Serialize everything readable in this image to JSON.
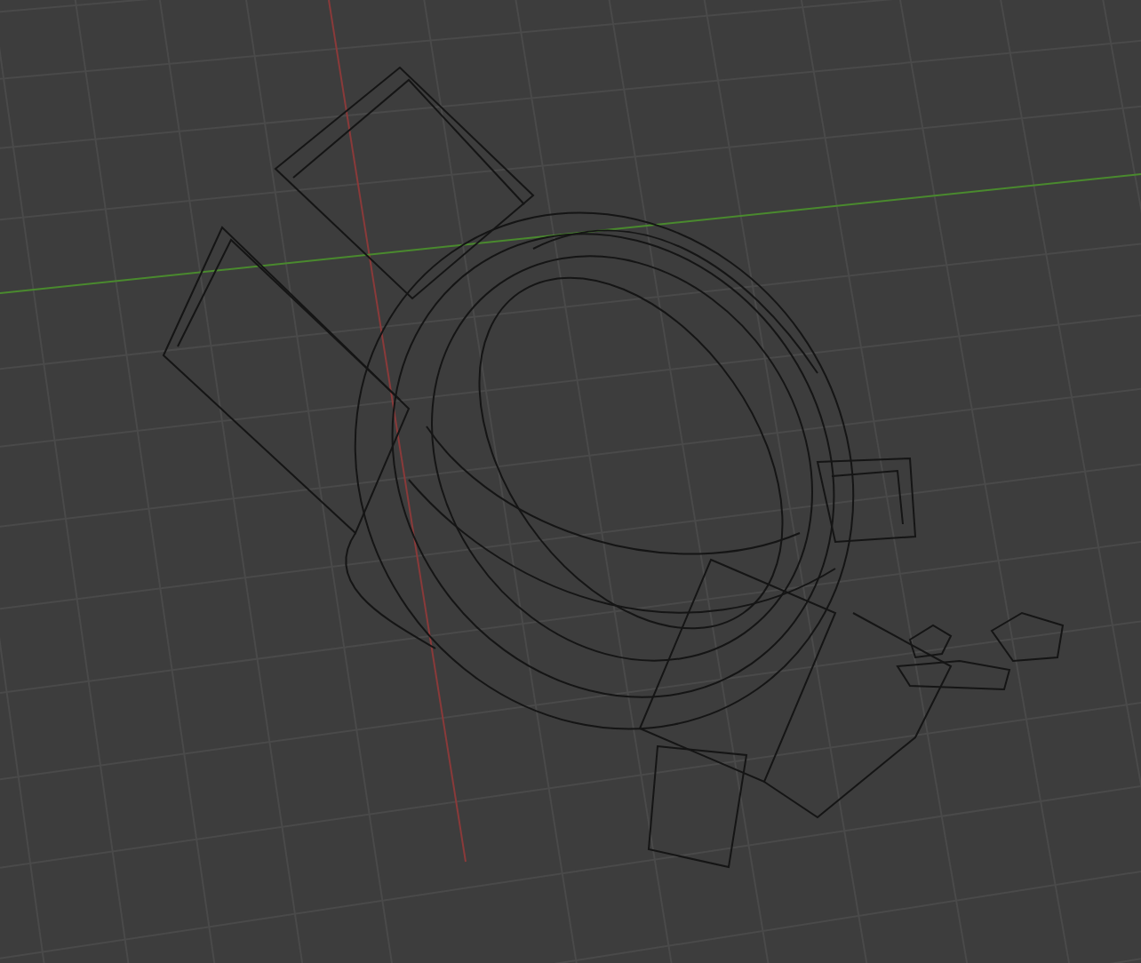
{
  "viewport": {
    "axes": [
      {
        "kind": "x",
        "color": "#8a3a3a"
      },
      {
        "kind": "y",
        "color": "#4a8a2e"
      }
    ]
  }
}
